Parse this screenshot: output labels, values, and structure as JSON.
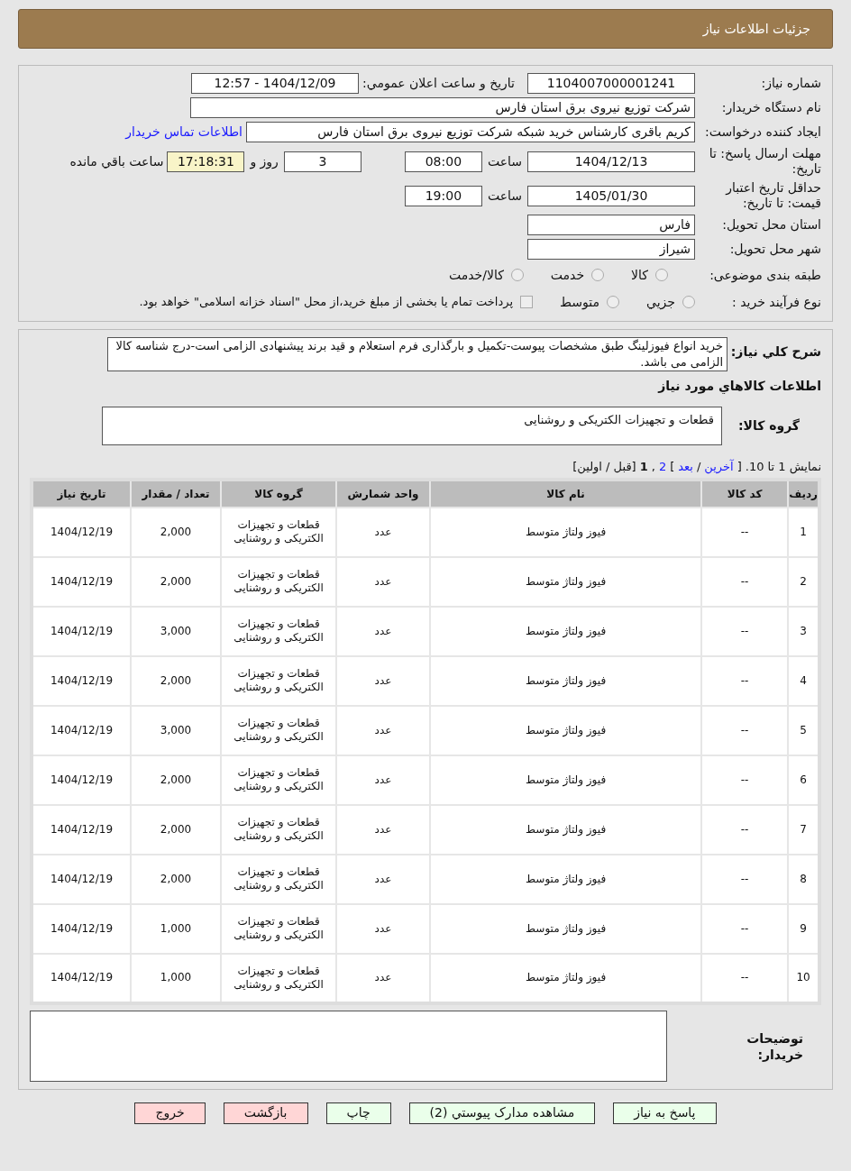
{
  "header": {
    "title": "جزئیات اطلاعات نیاز"
  },
  "form": {
    "need_number": {
      "label": "شماره نیاز:",
      "value": "1104007000001241"
    },
    "announce": {
      "label": "تاریخ و ساعت اعلان عمومي:",
      "value": "1404/12/09 - 12:57"
    },
    "buyer_org": {
      "label": "نام دستگاه خریدار:",
      "value": "شرکت توزیع نیروی برق استان فارس"
    },
    "requester": {
      "label": "ایجاد کننده درخواست:",
      "value": "کریم باقری کارشناس خرید شبکه شرکت توزیع نیروی برق استان فارس",
      "link": "اطلاعات تماس خریدار"
    },
    "deadline": {
      "label": "مهلت ارسال پاسخ: تا تاریخ:",
      "date": "1404/12/13",
      "time_label": "ساعت",
      "time": "08:00",
      "days": "3",
      "days_label": "روز و",
      "remaining": "17:18:31",
      "remaining_label": "ساعت باقي مانده"
    },
    "validity": {
      "label": "حداقل تاریخ اعتبار قیمت: تا تاریخ:",
      "date": "1405/01/30",
      "time_label": "ساعت",
      "time": "19:00"
    },
    "province": {
      "label": "استان محل تحویل:",
      "value": "فارس"
    },
    "city": {
      "label": "شهر محل تحویل:",
      "value": "شیراز"
    },
    "category": {
      "label": "طبقه بندی موضوعی:",
      "options": [
        {
          "label": "کالا",
          "selected": false
        },
        {
          "label": "خدمت",
          "selected": false
        },
        {
          "label": "کالا/خدمت",
          "selected": false
        }
      ]
    },
    "process": {
      "label": "نوع فرآیند خرید :",
      "options": [
        {
          "label": "جزيي",
          "selected": false
        },
        {
          "label": "متوسط",
          "selected": false
        }
      ],
      "payment": {
        "label": "پرداخت تمام یا بخشی از مبلغ خرید،از محل \"اسناد خزانه اسلامی\" خواهد بود.",
        "checked": false
      }
    }
  },
  "description": {
    "label": "شرح کلي نیاز:",
    "value": "خرید انواع فیوزلینگ طبق مشخصات پیوست-تکمیل و بارگذاری فرم استعلام و قید برند پیشنهادی الزامی است-درج شناسه کالا الزامی می باشد."
  },
  "goods_heading": "اطلاعات کالاهاي مورد نیاز",
  "goods_group": {
    "label": "گروه کالا:",
    "value": "قطعات و تجهیزات الکتریکی و روشنایی"
  },
  "pagination": [
    {
      "kind": "text",
      "text": "نمایش 1 تا 10."
    },
    {
      "kind": "text",
      "text": "["
    },
    {
      "kind": "link",
      "text": "آخرین"
    },
    {
      "kind": "text",
      "text": "/"
    },
    {
      "kind": "link",
      "text": "بعد"
    },
    {
      "kind": "text",
      "text": "]"
    },
    {
      "kind": "link",
      "text": "2"
    },
    {
      "kind": "text",
      "text": ","
    },
    {
      "kind": "bold",
      "text": "1"
    },
    {
      "kind": "text",
      "text": "[قبل / اولین]"
    }
  ],
  "table": {
    "columns": [
      "ردیف",
      "کد کالا",
      "نام کالا",
      "واحد شمارش",
      "گروه کالا",
      "تعداد / مقدار",
      "تاریخ نیاز"
    ],
    "rows": [
      [
        "1",
        "--",
        "فیوز ولتاژ متوسط",
        "عدد",
        "قطعات و تجهیزات الکتریکی و روشنایی",
        "2,000",
        "1404/12/19"
      ],
      [
        "2",
        "--",
        "فیوز ولتاژ متوسط",
        "عدد",
        "قطعات و تجهیزات الکتریکی و روشنایی",
        "2,000",
        "1404/12/19"
      ],
      [
        "3",
        "--",
        "فیوز ولتاژ متوسط",
        "عدد",
        "قطعات و تجهیزات الکتریکی و روشنایی",
        "3,000",
        "1404/12/19"
      ],
      [
        "4",
        "--",
        "فیوز ولتاژ متوسط",
        "عدد",
        "قطعات و تجهیزات الکتریکی و روشنایی",
        "2,000",
        "1404/12/19"
      ],
      [
        "5",
        "--",
        "فیوز ولتاژ متوسط",
        "عدد",
        "قطعات و تجهیزات الکتریکی و روشنایی",
        "3,000",
        "1404/12/19"
      ],
      [
        "6",
        "--",
        "فیوز ولتاژ متوسط",
        "عدد",
        "قطعات و تجهیزات الکتریکی و روشنایی",
        "2,000",
        "1404/12/19"
      ],
      [
        "7",
        "--",
        "فیوز ولتاژ متوسط",
        "عدد",
        "قطعات و تجهیزات الکتریکی و روشنایی",
        "2,000",
        "1404/12/19"
      ],
      [
        "8",
        "--",
        "فیوز ولتاژ متوسط",
        "عدد",
        "قطعات و تجهیزات الکتریکی و روشنایی",
        "2,000",
        "1404/12/19"
      ],
      [
        "9",
        "--",
        "فیوز ولتاژ متوسط",
        "عدد",
        "قطعات و تجهیزات الکتریکی و روشنایی",
        "1,000",
        "1404/12/19"
      ],
      [
        "10",
        "--",
        "فیوز ولتاژ متوسط",
        "عدد",
        "قطعات و تجهیزات الکتریکی و روشنایی",
        "1,000",
        "1404/12/19"
      ]
    ]
  },
  "buyer_notes": {
    "label": "توضیحات خریدار:"
  },
  "buttons": [
    {
      "label": "پاسخ به نیاز",
      "kind": "green"
    },
    {
      "label": "مشاهده مدارک پیوستي (2)",
      "kind": "green"
    },
    {
      "label": "چاپ",
      "kind": "green"
    },
    {
      "label": "بازگشت",
      "kind": "red"
    },
    {
      "label": "خروج",
      "kind": "red"
    }
  ]
}
